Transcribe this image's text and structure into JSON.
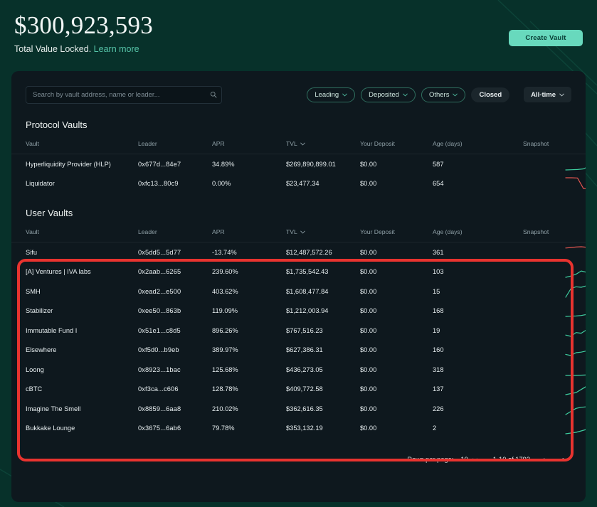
{
  "header": {
    "tvl_amount": "$300,923,593",
    "tvl_label": "Total Value Locked.",
    "learn_more": "Learn more",
    "create_vault": "Create Vault"
  },
  "toolbar": {
    "search_placeholder": "Search by vault address, name or leader...",
    "search_value": "",
    "filters": [
      {
        "label": "Leading",
        "style": "outline",
        "chevron": true
      },
      {
        "label": "Deposited",
        "style": "outline",
        "chevron": true
      },
      {
        "label": "Others",
        "style": "outline",
        "chevron": true
      },
      {
        "label": "Closed",
        "style": "solid",
        "chevron": false
      }
    ],
    "time_range": "All-time"
  },
  "columns": [
    "Vault",
    "Leader",
    "APR",
    "TVL",
    "Your Deposit",
    "Age (days)",
    "Snapshot"
  ],
  "protocol_section": {
    "title": "Protocol Vaults",
    "rows": [
      {
        "vault": "Hyperliquidity Provider (HLP)",
        "leader": "0x677d...84e7",
        "apr": "34.89%",
        "apr_trend": "pos",
        "tvl": "$269,890,899.01",
        "deposit": "$0.00",
        "age": "587",
        "spark_trend": "up",
        "spark": [
          6,
          6.2,
          6.4,
          7,
          9.5,
          12,
          14,
          16.5
        ]
      },
      {
        "vault": "Liquidator",
        "leader": "0xfc13...80c9",
        "apr": "0.00%",
        "apr_trend": "zero",
        "tvl": "$23,477.34",
        "deposit": "$0.00",
        "age": "654",
        "spark_trend": "down",
        "spark": [
          16,
          16,
          15.8,
          6,
          5.5,
          5.4,
          5.4,
          5.4
        ]
      }
    ]
  },
  "user_section": {
    "title": "User Vaults",
    "rows": [
      {
        "vault": "Sifu",
        "leader": "0x5dd5...5d77",
        "apr": "-13.74%",
        "apr_trend": "neg",
        "tvl": "$12,487,572.26",
        "deposit": "$0.00",
        "age": "361",
        "spark_trend": "down",
        "spark": [
          15,
          15.2,
          15.4,
          15.5,
          15.3,
          15.2,
          15.4,
          11,
          14
        ]
      },
      {
        "vault": "[A] Ventures | IVA labs",
        "leader": "0x2aab...6265",
        "apr": "239.60%",
        "apr_trend": "pos",
        "tvl": "$1,735,542.43",
        "deposit": "$0.00",
        "age": "103",
        "spark_trend": "up",
        "spark": [
          5,
          6,
          7.5,
          10,
          9,
          11,
          12.5,
          11.5,
          14
        ]
      },
      {
        "vault": "SMH",
        "leader": "0xead2...e500",
        "apr": "403.62%",
        "apr_trend": "pos",
        "tvl": "$1,608,477.84",
        "deposit": "$0.00",
        "age": "15",
        "spark_trend": "up",
        "spark": [
          3,
          12,
          14,
          13.5,
          15,
          14,
          10.5,
          11,
          11.5
        ]
      },
      {
        "vault": "Stabilizer",
        "leader": "0xee50...863b",
        "apr": "119.09%",
        "apr_trend": "pos",
        "tvl": "$1,212,003.94",
        "deposit": "$0.00",
        "age": "168",
        "spark_trend": "up",
        "spark": [
          5,
          5.2,
          5.5,
          6,
          7,
          9,
          12,
          15,
          17
        ]
      },
      {
        "vault": "Immutable Fund I",
        "leader": "0x51e1...c8d5",
        "apr": "896.26%",
        "apr_trend": "pos",
        "tvl": "$767,516.23",
        "deposit": "$0.00",
        "age": "19",
        "spark_trend": "up",
        "spark": [
          6,
          5,
          8,
          7.5,
          10,
          11.5,
          11,
          13,
          14
        ]
      },
      {
        "vault": "Elsewhere",
        "leader": "0xf5d0...b9eb",
        "apr": "389.97%",
        "apr_trend": "pos",
        "tvl": "$627,386.31",
        "deposit": "$0.00",
        "age": "160",
        "spark_trend": "up",
        "spark": [
          5,
          4,
          6.5,
          7,
          8,
          9.5,
          11,
          12.5,
          14
        ]
      },
      {
        "vault": "Loong",
        "leader": "0x8923...1bac",
        "apr": "125.68%",
        "apr_trend": "pos",
        "tvl": "$436,273.05",
        "deposit": "$0.00",
        "age": "318",
        "spark_trend": "up",
        "spark": [
          5,
          5,
          5,
          5.2,
          5.4,
          8,
          13,
          14,
          14
        ]
      },
      {
        "vault": "cBTC",
        "leader": "0xf3ca...c606",
        "apr": "128.78%",
        "apr_trend": "pos",
        "tvl": "$409,772.58",
        "deposit": "$0.00",
        "age": "137",
        "spark_trend": "up",
        "spark": [
          3,
          4,
          5,
          8,
          11,
          12,
          13,
          13.5,
          14
        ]
      },
      {
        "vault": "Imagine The Smell",
        "leader": "0x8859...6aa8",
        "apr": "210.02%",
        "apr_trend": "pos",
        "tvl": "$362,616.35",
        "deposit": "$0.00",
        "age": "226",
        "spark_trend": "up",
        "spark": [
          3,
          6,
          9,
          10,
          10.5,
          12,
          13,
          13.5,
          14
        ]
      },
      {
        "vault": "Bukkake Lounge",
        "leader": "0x3675...6ab6",
        "apr": "79.78%",
        "apr_trend": "pos",
        "tvl": "$353,132.19",
        "deposit": "$0.00",
        "age": "2",
        "spark_trend": "up",
        "spark": [
          5,
          5.5,
          6,
          7,
          8,
          8.5,
          9,
          13,
          11
        ]
      }
    ]
  },
  "footer": {
    "rows_per_page_label": "Rows per page:",
    "rows_per_page_value": "10",
    "range": "1-10 of 1793",
    "prev": "‹",
    "next": "›"
  },
  "colors": {
    "accent": "#68d9bd",
    "positive": "#3ecfa0",
    "negative": "#e0554f",
    "highlight": "#e8332f",
    "page_bg": "#07312a",
    "card_bg": "#0e181e"
  }
}
